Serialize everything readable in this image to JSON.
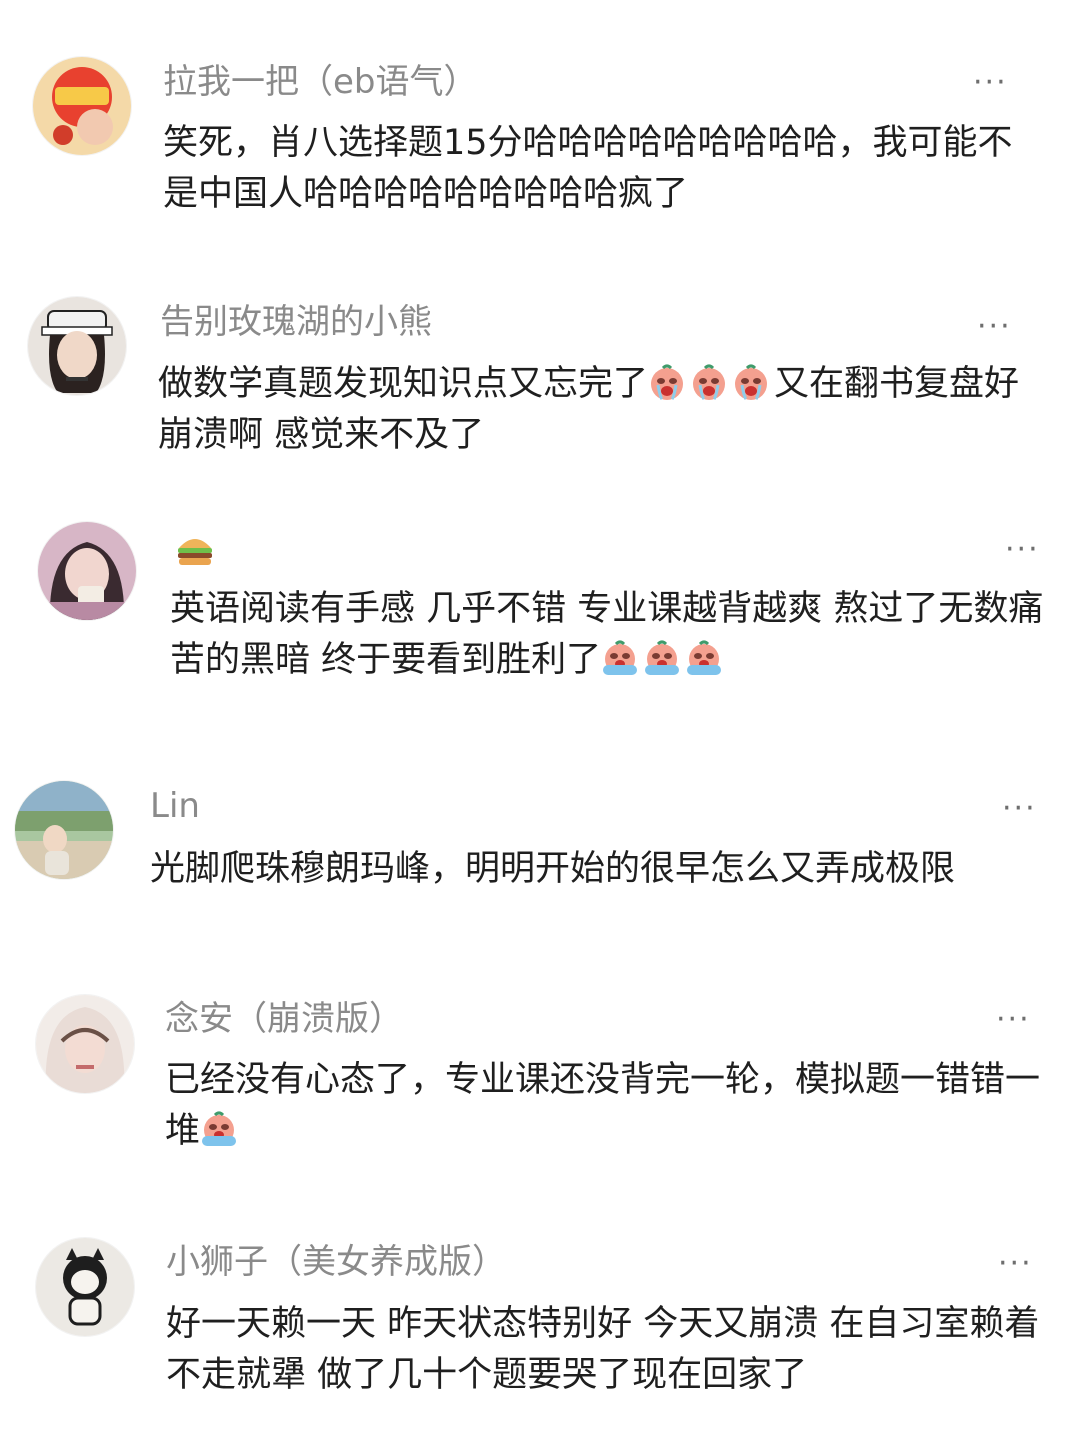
{
  "comments": [
    {
      "username": "拉我一把（eb语气）",
      "text_1": "笑死，肖八选择题15分哈哈哈哈哈哈哈哈哈，我可能不是中国人哈哈哈哈哈哈哈哈哈疯了"
    },
    {
      "username": "告别玫瑰湖的小熊",
      "text_1": "做数学真题发现知识点又忘完了",
      "emoji_1": "crying-peach-emoji",
      "text_2": "又在翻书复盘好崩溃啊 感觉来不及了"
    },
    {
      "username_icon": "hamburger-emoji",
      "text_1": "英语阅读有手感 几乎不错 专业课越背越爽 熬过了无数痛苦的黑暗 终于要看到胜利了",
      "emoji_1": "tearful-peach-emoji"
    },
    {
      "username": "Lin",
      "text_1": "光脚爬珠穆朗玛峰，明明开始的很早怎么又弄成极限"
    },
    {
      "username": "念安（崩溃版）",
      "text_1": "已经没有心态了，专业课还没背完一轮，模拟题一错错一堆",
      "emoji_1": "tearful-peach-emoji"
    },
    {
      "username": "小狮子（美女养成版）",
      "text_1": "好一天赖一天 昨天状态特别好 今天又崩溃 在自习室赖着不走就犟 做了几十个题要哭了现在回家了"
    }
  ],
  "more_label": "···",
  "colors": {
    "username": "#8a8a8a",
    "text": "#1f1f1f",
    "more": "#6e6e6e"
  }
}
